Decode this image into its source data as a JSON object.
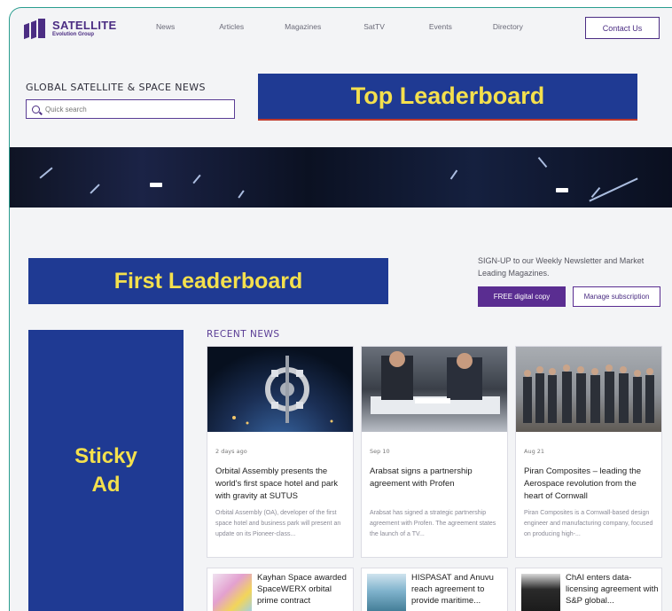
{
  "header": {
    "logo_title": "SATELLITE",
    "logo_sub": "Evolution Group",
    "nav": [
      "News",
      "Articles",
      "Magazines",
      "SatTV",
      "Events",
      "Directory"
    ],
    "contact_label": "Contact Us"
  },
  "hero": {
    "tagline": "GLOBAL SATELLITE & SPACE NEWS",
    "search_placeholder": "Quick search",
    "top_ad": "Top Leaderboard"
  },
  "first_ad": "First Leaderboard",
  "signup": {
    "text": "SIGN-UP to our Weekly Newsletter and Market Leading Magazines.",
    "free_label": "FREE digital copy",
    "manage_label": "Manage subscription"
  },
  "sticky_ad": "Sticky Ad",
  "recent": {
    "heading": "RECENT NEWS",
    "cards": [
      {
        "date": "2 days ago",
        "title": "Orbital Assembly presents the world's first space hotel and park with gravity at SUTUS",
        "excerpt": "Orbital Assembly (OA), developer of the first space hotel and business park will present an update on its Pioneer-class..."
      },
      {
        "date": "Sep 10",
        "title": "Arabsat signs a partnership agreement with Profen",
        "excerpt": "Arabsat has signed a strategic partnership agreement with Profen. The agreement states the launch of a TV..."
      },
      {
        "date": "Aug 21",
        "title": "Piran Composites – leading the Aerospace revolution from the heart of Cornwall",
        "excerpt": "Piran Composites is a Cornwall-based design engineer and manufacturing company, focused on producing high-..."
      }
    ],
    "mini": [
      {
        "title": "Kayhan Space awarded SpaceWERX orbital prime contract"
      },
      {
        "title": "HISPASAT and Anuvu reach agreement to provide maritime..."
      },
      {
        "title": "ChAI enters data-licensing agreement with S&P global..."
      }
    ]
  },
  "colors": {
    "brand": "#4b2d83",
    "ad_bg": "#1f3a93",
    "ad_text": "#f4e04d"
  }
}
